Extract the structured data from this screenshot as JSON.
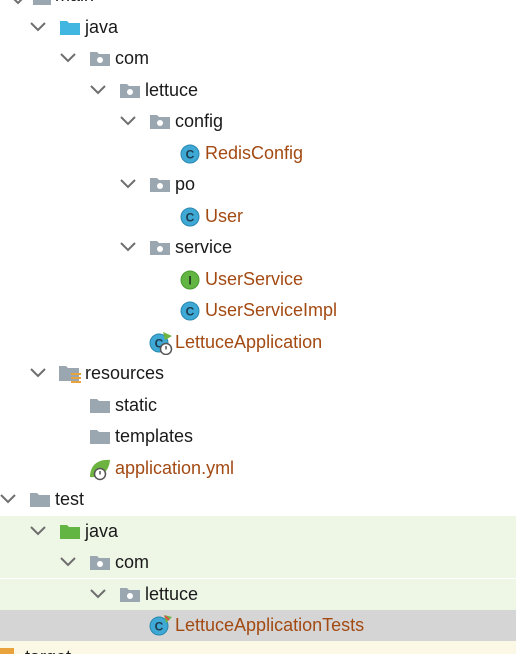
{
  "tree": {
    "top_partial": {
      "label": "main"
    },
    "items": [
      {
        "label": "java",
        "kind": "source-folder",
        "expanded": true
      },
      {
        "label": "com",
        "kind": "package",
        "expanded": true
      },
      {
        "label": "lettuce",
        "kind": "package",
        "expanded": true
      },
      {
        "label": "config",
        "kind": "package",
        "expanded": true
      },
      {
        "label": "RedisConfig",
        "kind": "class"
      },
      {
        "label": "po",
        "kind": "package",
        "expanded": true
      },
      {
        "label": "User",
        "kind": "class"
      },
      {
        "label": "service",
        "kind": "package",
        "expanded": true
      },
      {
        "label": "UserService",
        "kind": "interface"
      },
      {
        "label": "UserServiceImpl",
        "kind": "class"
      },
      {
        "label": "LettuceApplication",
        "kind": "spring-boot-class"
      },
      {
        "label": "resources",
        "kind": "resources-folder",
        "expanded": true
      },
      {
        "label": "static",
        "kind": "folder"
      },
      {
        "label": "templates",
        "kind": "folder"
      },
      {
        "label": "application.yml",
        "kind": "spring-config"
      },
      {
        "label": "test",
        "kind": "folder",
        "expanded": true
      },
      {
        "label": "java",
        "kind": "test-source-folder",
        "expanded": true
      },
      {
        "label": "com",
        "kind": "package",
        "expanded": true
      },
      {
        "label": "lettuce",
        "kind": "package",
        "expanded": true
      },
      {
        "label": "LettuceApplicationTests",
        "kind": "test-class",
        "selected": true
      }
    ],
    "bottom_partial": {
      "label": "target"
    }
  },
  "colors": {
    "class_label": "#a34a13",
    "class_icon": "#3ea9d4",
    "interface_icon": "#62b543",
    "folder": "#9aa7b0",
    "source_folder": "#40b6e0",
    "test_folder": "#62b543",
    "test_region_bg": "#eef6e6",
    "selected_bg": "#d5d5d5",
    "spring_green": "#6db33f"
  }
}
